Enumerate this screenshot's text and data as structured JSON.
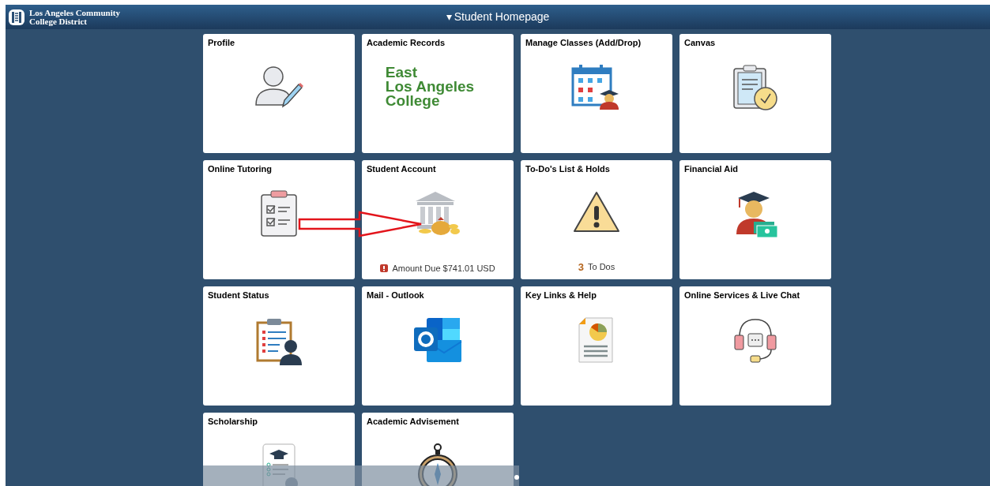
{
  "header": {
    "logo_lines": [
      "Los Angeles Community",
      "College District"
    ],
    "title_caret": "▾",
    "title": "Student Homepage"
  },
  "tiles": [
    {
      "title": "Profile"
    },
    {
      "title": "Academic Records",
      "logo_lines": [
        "East",
        "Los Angeles",
        "College"
      ]
    },
    {
      "title": "Manage Classes (Add/Drop)"
    },
    {
      "title": "Canvas"
    },
    {
      "title": "Online Tutoring"
    },
    {
      "title": "Student Account",
      "footer": {
        "kind": "alert",
        "text": "Amount Due $741.01 USD"
      }
    },
    {
      "title": "To-Do's List & Holds",
      "footer": {
        "kind": "count",
        "count": "3",
        "text": "To Dos"
      }
    },
    {
      "title": "Financial Aid"
    },
    {
      "title": "Student Status"
    },
    {
      "title": "Mail - Outlook"
    },
    {
      "title": "Key Links & Help"
    },
    {
      "title": "Online Services & Live Chat"
    },
    {
      "title": "Scholarship"
    },
    {
      "title": "Academic Advisement"
    }
  ]
}
